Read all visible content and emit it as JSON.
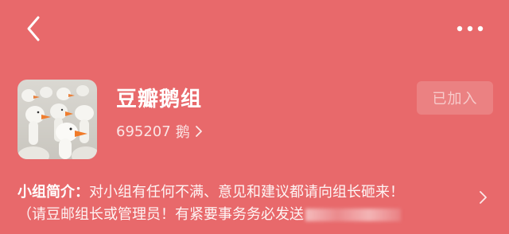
{
  "header": {
    "back_icon": "chevron-left-icon",
    "more_icon": "more-horizontal-icon"
  },
  "group": {
    "name": "豆瓣鹅组",
    "member_count": "695207",
    "member_unit": "鹅",
    "joined_label": "已加入",
    "avatar": "goose-flock-image"
  },
  "intro": {
    "label": "小组简介：",
    "line1": "对小组有任何不满、意见和建议都请向组长砸来！",
    "line2": "（请豆邮组长或管理员！有紧要事务务必发送",
    "chevron_icon": "chevron-right-icon"
  },
  "colors": {
    "background": "#e8696b",
    "text": "#ffffff"
  }
}
